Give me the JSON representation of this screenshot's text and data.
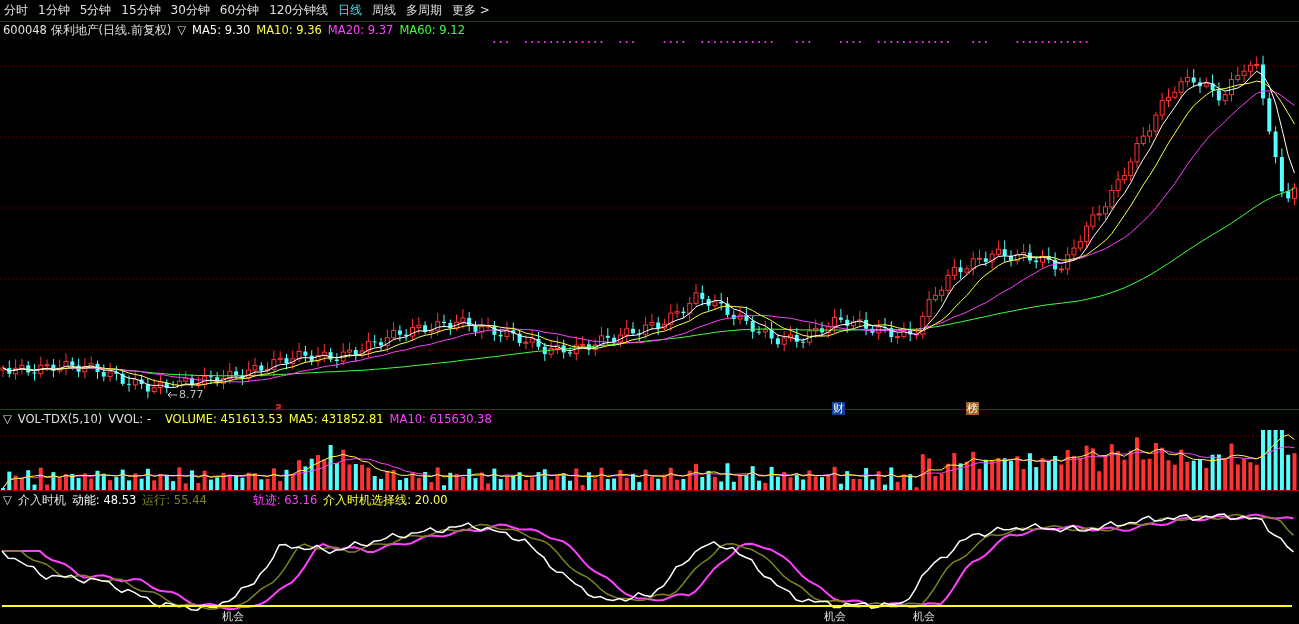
{
  "menu_tabs": [
    {
      "label": "分时",
      "selected": false
    },
    {
      "label": "1分钟",
      "selected": false
    },
    {
      "label": "5分钟",
      "selected": false
    },
    {
      "label": "15分钟",
      "selected": false
    },
    {
      "label": "30分钟",
      "selected": false
    },
    {
      "label": "60分钟",
      "selected": false
    },
    {
      "label": "120分钟线",
      "selected": false
    },
    {
      "label": "日线",
      "selected": true
    },
    {
      "label": "周线",
      "selected": false
    },
    {
      "label": "多周期",
      "selected": false
    },
    {
      "label": "更多 >",
      "selected": false
    }
  ],
  "price_pane": {
    "toggle": "▽",
    "symbol": "600048 保利地产(日线.前复权)",
    "items": [
      {
        "label": "MA5: 9.30",
        "color": "#ffffff"
      },
      {
        "label": "MA10: 9.36",
        "color": "#ffff40"
      },
      {
        "label": "MA20: 9.37",
        "color": "#ff40ff"
      },
      {
        "label": "MA60: 9.12",
        "color": "#40ff40"
      }
    ],
    "low_label": "8.77",
    "event_markers": [
      {
        "label": "财",
        "kind": "finance"
      },
      {
        "label": "榜",
        "kind": "ranking"
      }
    ]
  },
  "volume_pane": {
    "toggle": "▽",
    "name": "VOL-TDX(5,10)",
    "sub": "VVOL: -",
    "items": [
      {
        "label": "VOLUME: 451613.53",
        "color": "#ffff40"
      },
      {
        "label": "MA5: 431852.81",
        "color": "#ffff40"
      },
      {
        "label": "MA10: 615630.38",
        "color": "#ff40ff"
      }
    ]
  },
  "indicator_pane": {
    "toggle": "▽",
    "name": "介入时机",
    "items": [
      {
        "label": "动能: 48.53",
        "color": "#ffffff"
      },
      {
        "label": "运行: 55.44",
        "color": "#808020"
      },
      {
        "label": "轨迹: 63.16",
        "color": "#ff40ff"
      },
      {
        "label": "介入时机选择线: 20.00",
        "color": "#ffff40"
      }
    ],
    "signals": [
      "机会",
      "机会",
      "机会"
    ]
  }
}
